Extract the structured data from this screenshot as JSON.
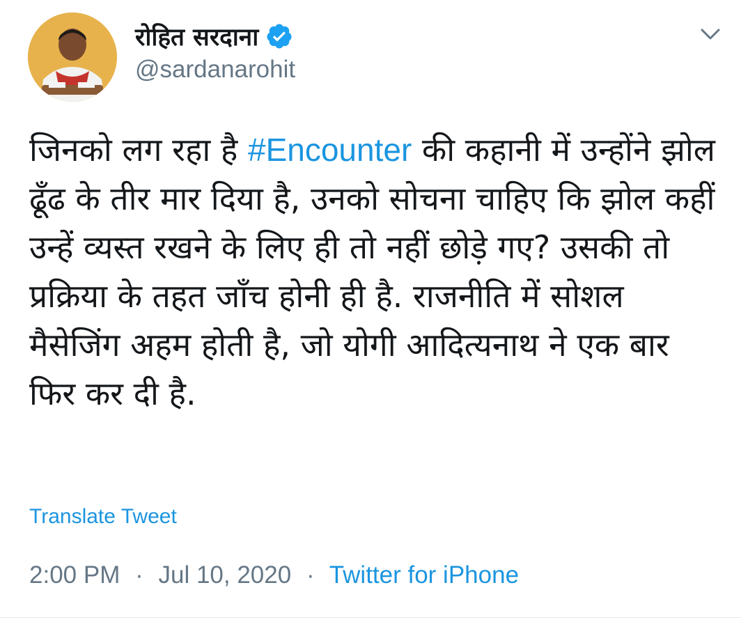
{
  "user": {
    "display_name": "रोहित सरदाना",
    "handle": "@sardanarohit",
    "verified": true
  },
  "tweet": {
    "text_before": "जिनको लग रहा है ",
    "hashtag": "#Encounter",
    "text_after": " की कहानी में उन्होंने झोल ढूँढ के तीर मार दिया है, उनको सोचना चाहिए कि झोल कहीं उन्हें व्यस्त रखने के लिए ही तो नहीं छोड़े गए? उसकी तो प्रक्रिया के तहत जाँच होनी ही है. राजनीति में सोशल मैसेजिंग अहम होती है, जो योगी आदित्यनाथ ने एक बार फिर कर दी है.",
    "translate_label": "Translate Tweet",
    "time": "2:00 PM",
    "separator": "·",
    "date": "Jul 10, 2020",
    "source": "Twitter for iPhone"
  },
  "icons": {
    "verified": "verified-badge-icon",
    "menu": "chevron-down-icon"
  },
  "colors": {
    "link": "#1b95e0",
    "secondary_text": "#657786",
    "primary_text": "#14171a",
    "verified_badge": "#1da1f2"
  }
}
